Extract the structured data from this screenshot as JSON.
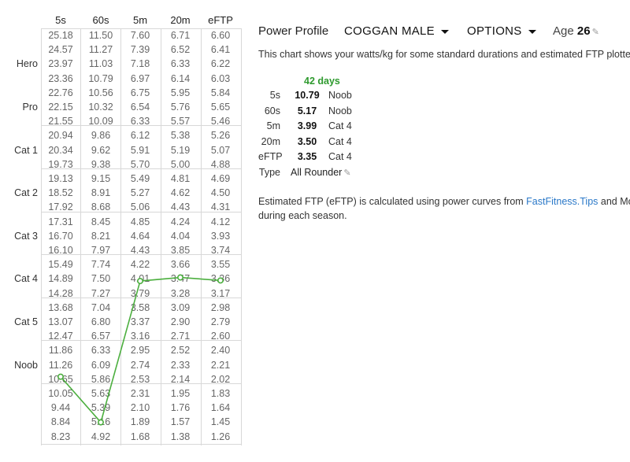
{
  "grid": {
    "columns": [
      "5s",
      "60s",
      "5m",
      "20m",
      "eFTP"
    ],
    "ranks": [
      {
        "label": "Hero",
        "row": 2
      },
      {
        "label": "Pro",
        "row": 5
      },
      {
        "label": "Cat 1",
        "row": 8
      },
      {
        "label": "Cat 2",
        "row": 11
      },
      {
        "label": "Cat 3",
        "row": 14
      },
      {
        "label": "Cat 4",
        "row": 17
      },
      {
        "label": "Cat 5",
        "row": 20
      },
      {
        "label": "Noob",
        "row": 23
      }
    ],
    "rows": [
      [
        "25.18",
        "11.50",
        "7.60",
        "6.71",
        "6.60"
      ],
      [
        "24.57",
        "11.27",
        "7.39",
        "6.52",
        "6.41"
      ],
      [
        "23.97",
        "11.03",
        "7.18",
        "6.33",
        "6.22"
      ],
      [
        "23.36",
        "10.79",
        "6.97",
        "6.14",
        "6.03"
      ],
      [
        "22.76",
        "10.56",
        "6.75",
        "5.95",
        "5.84"
      ],
      [
        "22.15",
        "10.32",
        "6.54",
        "5.76",
        "5.65"
      ],
      [
        "21.55",
        "10.09",
        "6.33",
        "5.57",
        "5.46"
      ],
      [
        "20.94",
        "9.86",
        "6.12",
        "5.38",
        "5.26"
      ],
      [
        "20.34",
        "9.62",
        "5.91",
        "5.19",
        "5.07"
      ],
      [
        "19.73",
        "9.38",
        "5.70",
        "5.00",
        "4.88"
      ],
      [
        "19.13",
        "9.15",
        "5.49",
        "4.81",
        "4.69"
      ],
      [
        "18.52",
        "8.91",
        "5.27",
        "4.62",
        "4.50"
      ],
      [
        "17.92",
        "8.68",
        "5.06",
        "4.43",
        "4.31"
      ],
      [
        "17.31",
        "8.45",
        "4.85",
        "4.24",
        "4.12"
      ],
      [
        "16.70",
        "8.21",
        "4.64",
        "4.04",
        "3.93"
      ],
      [
        "16.10",
        "7.97",
        "4.43",
        "3.85",
        "3.74"
      ],
      [
        "15.49",
        "7.74",
        "4.22",
        "3.66",
        "3.55"
      ],
      [
        "14.89",
        "7.50",
        "4.01",
        "3.47",
        "3.36"
      ],
      [
        "14.28",
        "7.27",
        "3.79",
        "3.28",
        "3.17"
      ],
      [
        "13.68",
        "7.04",
        "3.58",
        "3.09",
        "2.98"
      ],
      [
        "13.07",
        "6.80",
        "3.37",
        "2.90",
        "2.79"
      ],
      [
        "12.47",
        "6.57",
        "3.16",
        "2.71",
        "2.60"
      ],
      [
        "11.86",
        "6.33",
        "2.95",
        "2.52",
        "2.40"
      ],
      [
        "11.26",
        "6.09",
        "2.74",
        "2.33",
        "2.21"
      ],
      [
        "10.65",
        "5.86",
        "2.53",
        "2.14",
        "2.02"
      ],
      [
        "10.05",
        "5.63",
        "2.31",
        "1.95",
        "1.83"
      ],
      [
        "9.44",
        "5.39",
        "2.10",
        "1.76",
        "1.64"
      ],
      [
        "8.84",
        "5.16",
        "1.89",
        "1.57",
        "1.45"
      ],
      [
        "8.23",
        "4.92",
        "1.68",
        "1.38",
        "1.26"
      ]
    ]
  },
  "profile_line": {
    "color": "#4caf3f",
    "points": [
      {
        "column": "5s",
        "value": 10.79
      },
      {
        "column": "60s",
        "value": 5.17
      },
      {
        "column": "5m",
        "value": 3.99
      },
      {
        "column": "20m",
        "value": 3.5
      },
      {
        "column": "eFTP",
        "value": 3.35
      }
    ]
  },
  "header": {
    "title": "Power Profile",
    "profile_dropdown": "COGGAN MALE",
    "options_dropdown": "OPTIONS",
    "age_label": "Age",
    "age_value": "26",
    "edit_icon": "pencil-icon"
  },
  "description": "This chart shows your watts/kg for some standard durations and estimated FTP plotted",
  "summary": {
    "period": "42 days",
    "rows": [
      {
        "label": "5s",
        "value": "10.79",
        "category": "Noob"
      },
      {
        "label": "60s",
        "value": "5.17",
        "category": "Noob"
      },
      {
        "label": "5m",
        "value": "3.99",
        "category": "Cat 4"
      },
      {
        "label": "20m",
        "value": "3.50",
        "category": "Cat 4"
      },
      {
        "label": "eFTP",
        "value": "3.35",
        "category": "Cat 4"
      }
    ],
    "type_label": "Type",
    "type_value": "All Rounder"
  },
  "note": {
    "before_link": "Estimated FTP (eFTP) is calculated using power curves from ",
    "link_text": "FastFitness.Tips",
    "after_link": " and Mort",
    "line2": "during each season."
  },
  "colors": {
    "accent_green": "#2e9a2e",
    "link_blue": "#2a78c8",
    "gridline": "#d8d8d8"
  }
}
